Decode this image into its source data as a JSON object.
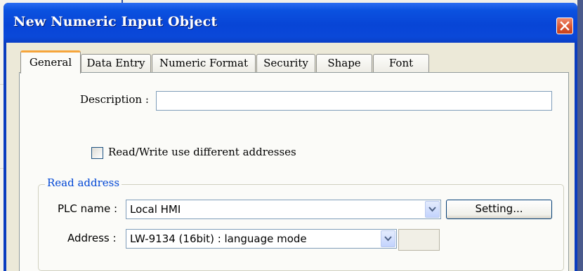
{
  "window": {
    "title": "New  Numeric Input Object"
  },
  "tabs": [
    {
      "label": "General",
      "active": true
    },
    {
      "label": "Data Entry",
      "active": false
    },
    {
      "label": "Numeric Format",
      "active": false
    },
    {
      "label": "Security",
      "active": false
    },
    {
      "label": "Shape",
      "active": false
    },
    {
      "label": "Font",
      "active": false
    }
  ],
  "general": {
    "description_label": "Description :",
    "description_value": "",
    "rw_checkbox_label": "Read/Write use different addresses",
    "rw_checkbox_checked": false,
    "read_address": {
      "group_title": "Read address",
      "plc_name_label": "PLC name :",
      "plc_name_value": "Local HMI",
      "setting_button": "Setting...",
      "address_label": "Address :",
      "address_value": "LW-9134 (16bit) : language mode"
    }
  },
  "colors": {
    "titlebar": "#0b52e0",
    "dialog_bg": "#ece9d8",
    "active_tab_accent": "#f6a53b",
    "group_title": "#0046d5"
  }
}
